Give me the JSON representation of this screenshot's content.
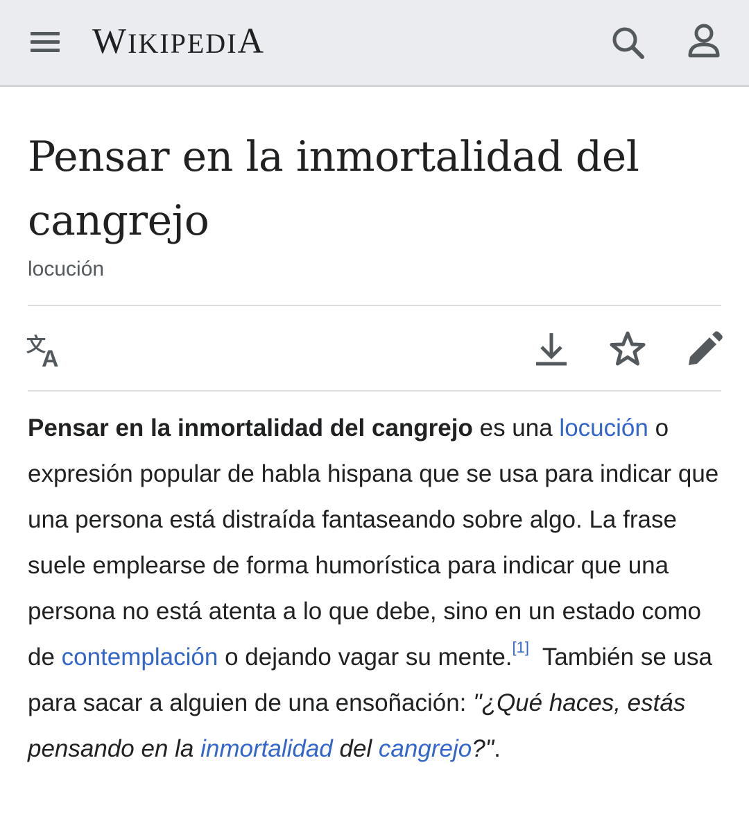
{
  "header": {
    "logo_main": "W",
    "logo_rest": "IKIPEDI",
    "logo_end": "A",
    "menu_icon": "hamburger-menu-icon",
    "search_icon": "search-icon",
    "user_icon": "user-icon",
    "background": "#eaecf0"
  },
  "article": {
    "title": "Pensar en la inmortalidad del cangrejo",
    "subtitle": "locución",
    "toolbar": {
      "language_icon": "translate-icon",
      "download_icon": "download-icon",
      "watch_icon": "star-icon",
      "edit_icon": "pencil-icon"
    },
    "body": {
      "lead_bold": "Pensar en la inmortalidad del cangrejo",
      "text_1": " es una ",
      "link_1": "locución",
      "text_2": " o expresión popular de habla hispana que se usa para indicar que una persona está distraída fantaseando sobre algo. La frase suele emplearse de forma humorística para indicar que una persona no está atenta a lo que debe, sino en un estado como de ",
      "link_2": "contemplación",
      "text_3": " o dejando vagar su mente.",
      "reference": "[1]",
      "text_4": "  También se usa para sacar a alguien de una ensoñación: ",
      "quote_1": "\"¿Qué haces, estás pensando en la ",
      "link_3": "inmortalidad",
      "quote_2": " del ",
      "link_4": "cangrejo",
      "quote_3": "?\"",
      "end": "."
    },
    "link_color": "#3366cc"
  }
}
